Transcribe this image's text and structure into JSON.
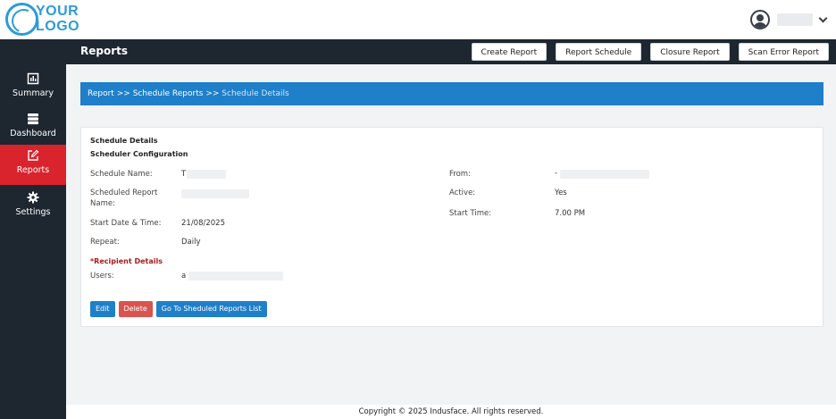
{
  "header": {
    "logo_text_line1": "YOUR",
    "logo_text_line2": "LOGO"
  },
  "titlebar": {
    "page_title": "Reports",
    "buttons": [
      "Create Report",
      "Report Schedule",
      "Closure Report",
      "Scan Error Report"
    ]
  },
  "sidebar": {
    "items": [
      {
        "label": "Summary",
        "icon": "summary-icon",
        "active": false
      },
      {
        "label": "Dashboard",
        "icon": "dashboard-icon",
        "active": false
      },
      {
        "label": "Reports",
        "icon": "edit-icon",
        "active": true
      },
      {
        "label": "Settings",
        "icon": "gear-icon",
        "active": false
      }
    ]
  },
  "breadcrumb": {
    "part1": "Report",
    "sep": ">>",
    "part2": "Schedule Reports",
    "current": "Schedule Details"
  },
  "details": {
    "heading": "Schedule Details",
    "subheading": "Scheduler Configuration",
    "schedule_name_label": "Schedule Name:",
    "schedule_name_value": "T",
    "scheduled_report_name_label_1": "Scheduled Report",
    "scheduled_report_name_label_2": "Name:",
    "start_date_label": "Start Date & Time:",
    "start_date_value": "21/08/2025",
    "repeat_label": "Repeat:",
    "repeat_value": "Daily",
    "from_label": "From:",
    "from_value": "-",
    "active_label": "Active:",
    "active_value": "Yes",
    "start_time_label": "Start Time:",
    "start_time_value": "7.00 PM",
    "recipient_heading": "*Recipient Details",
    "users_label": "Users:",
    "users_value": "a"
  },
  "actions": {
    "edit": "Edit",
    "delete": "Delete",
    "goto": "Go To Sheduled Reports List"
  },
  "footer": {
    "copyright": "Copyright © 2025 Indusface. All rights reserved."
  },
  "colors": {
    "brand_blue": "#1f7fc9",
    "active_red": "#d9232d",
    "dark_nav": "#1e2630"
  }
}
